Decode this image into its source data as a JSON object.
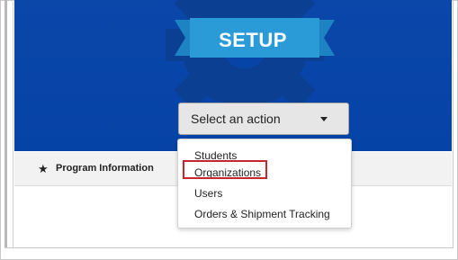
{
  "hero": {
    "title": "SETUP",
    "background_color": "#0643a6",
    "gear_color": "#0b3f8f",
    "ribbon_color": "#2a9bd6"
  },
  "action_select": {
    "label": "Select an action",
    "caret_icon": "caret-down-icon",
    "expanded": true
  },
  "dropdown": {
    "items": [
      {
        "label": "Students"
      },
      {
        "label": "Organizations",
        "highlighted": true
      },
      {
        "label": "Users"
      },
      {
        "label": "Orders & Shipment Tracking"
      }
    ],
    "highlight_color": "#c8262e"
  },
  "program_info": {
    "icon": "star-icon",
    "title": "Program Information"
  }
}
